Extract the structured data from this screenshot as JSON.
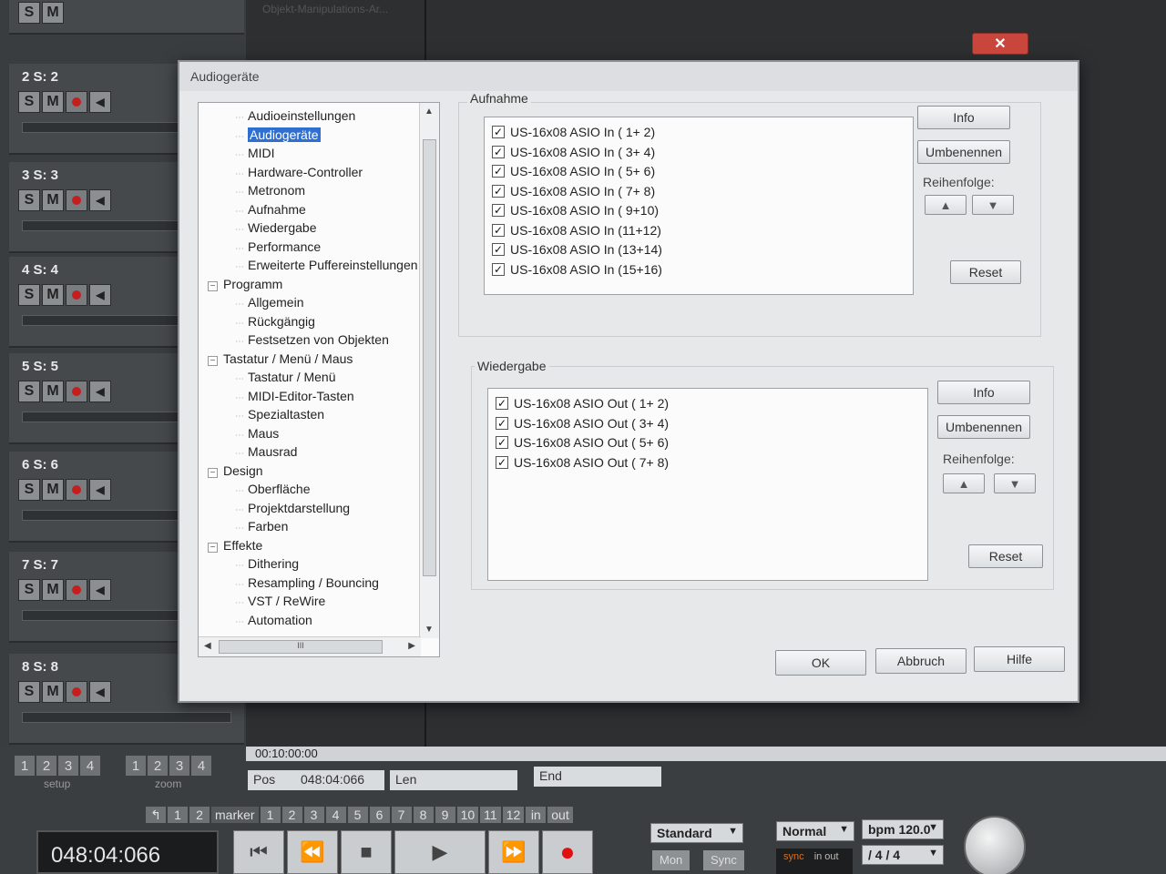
{
  "background": {
    "arrange_clip_label": "Objekt-Manipulations-Ar...",
    "tracks": [
      {
        "label": "2   S: 2"
      },
      {
        "label": "3   S: 3"
      },
      {
        "label": "4   S: 4"
      },
      {
        "label": "5   S: 5"
      },
      {
        "label": "6   S: 6"
      },
      {
        "label": "7   S: 7"
      },
      {
        "label": "8   S: 8"
      }
    ],
    "track_buttons": {
      "solo": "S",
      "mute": "M"
    },
    "setup_numbers": [
      "1",
      "2",
      "3",
      "4"
    ],
    "setup_label": "setup",
    "zoom_numbers": [
      "1",
      "2",
      "3",
      "4"
    ],
    "zoom_label": "zoom",
    "timeline_time": "00:10:00:00",
    "pos_label": "Pos",
    "pos_value": "048:04:066",
    "len_label": "Len",
    "end_label": "End",
    "marker_nav": [
      "↰",
      "1",
      "2"
    ],
    "marker_label": "marker",
    "marker_numbers": [
      "1",
      "2",
      "3",
      "4",
      "5",
      "6",
      "7",
      "8",
      "9",
      "10",
      "11",
      "12"
    ],
    "in_label": "in",
    "out_label": "out",
    "counter": "048:04:066",
    "standard_select": "Standard",
    "mon_label": "Mon",
    "sync_label": "Sync",
    "normal_select": "Normal",
    "bpm_select": "bpm 120.0",
    "signature_select": "/    4 / 4",
    "sync_small": "sync",
    "in_out_small": "in  out"
  },
  "dialog": {
    "title": "Audiogeräte",
    "close_label": "✕",
    "tree": [
      {
        "label": "Audioeinstellungen",
        "level": 1
      },
      {
        "label": "Audiogeräte",
        "level": 1,
        "selected": true
      },
      {
        "label": "MIDI",
        "level": 1
      },
      {
        "label": "Hardware-Controller",
        "level": 1
      },
      {
        "label": "Metronom",
        "level": 1
      },
      {
        "label": "Aufnahme",
        "level": 1
      },
      {
        "label": "Wiedergabe",
        "level": 1
      },
      {
        "label": "Performance",
        "level": 1
      },
      {
        "label": "Erweiterte Puffereinstellungen",
        "level": 1
      },
      {
        "label": "Programm",
        "level": 0
      },
      {
        "label": "Allgemein",
        "level": 1
      },
      {
        "label": "Rückgängig",
        "level": 1
      },
      {
        "label": "Festsetzen von Objekten",
        "level": 1
      },
      {
        "label": "Tastatur / Menü / Maus",
        "level": 0
      },
      {
        "label": "Tastatur / Menü",
        "level": 1
      },
      {
        "label": "MIDI-Editor-Tasten",
        "level": 1
      },
      {
        "label": "Spezialtasten",
        "level": 1
      },
      {
        "label": "Maus",
        "level": 1
      },
      {
        "label": "Mausrad",
        "level": 1
      },
      {
        "label": "Design",
        "level": 0
      },
      {
        "label": "Oberfläche",
        "level": 1
      },
      {
        "label": "Projektdarstellung",
        "level": 1
      },
      {
        "label": "Farben",
        "level": 1
      },
      {
        "label": "Effekte",
        "level": 0
      },
      {
        "label": "Dithering",
        "level": 1
      },
      {
        "label": "Resampling / Bouncing",
        "level": 1
      },
      {
        "label": "VST / ReWire",
        "level": 1
      },
      {
        "label": "Automation",
        "level": 1
      }
    ],
    "expander_symbol": "−",
    "scroll_thumb_grip": "III",
    "aufnahme": {
      "label": "Aufnahme",
      "devices": [
        "US-16x08 ASIO In ( 1+ 2)",
        "US-16x08 ASIO In ( 3+ 4)",
        "US-16x08 ASIO In ( 5+ 6)",
        "US-16x08 ASIO In ( 7+ 8)",
        "US-16x08 ASIO In ( 9+10)",
        "US-16x08 ASIO In (11+12)",
        "US-16x08 ASIO In (13+14)",
        "US-16x08 ASIO In (15+16)"
      ],
      "info_label": "Info",
      "rename_label": "Umbenennen",
      "order_label": "Reihenfolge:",
      "up_symbol": "▲",
      "down_symbol": "▼",
      "reset_label": "Reset"
    },
    "wiedergabe": {
      "label": "Wiedergabe",
      "devices": [
        "US-16x08 ASIO Out ( 1+ 2)",
        "US-16x08 ASIO Out ( 3+ 4)",
        "US-16x08 ASIO Out ( 5+ 6)",
        "US-16x08 ASIO Out ( 7+ 8)"
      ],
      "info_label": "Info",
      "rename_label": "Umbenennen",
      "order_label": "Reihenfolge:",
      "up_symbol": "▲",
      "down_symbol": "▼",
      "reset_label": "Reset"
    },
    "check_mark": "✓",
    "ok_label": "OK",
    "cancel_label": "Abbruch",
    "help_label": "Hilfe"
  }
}
